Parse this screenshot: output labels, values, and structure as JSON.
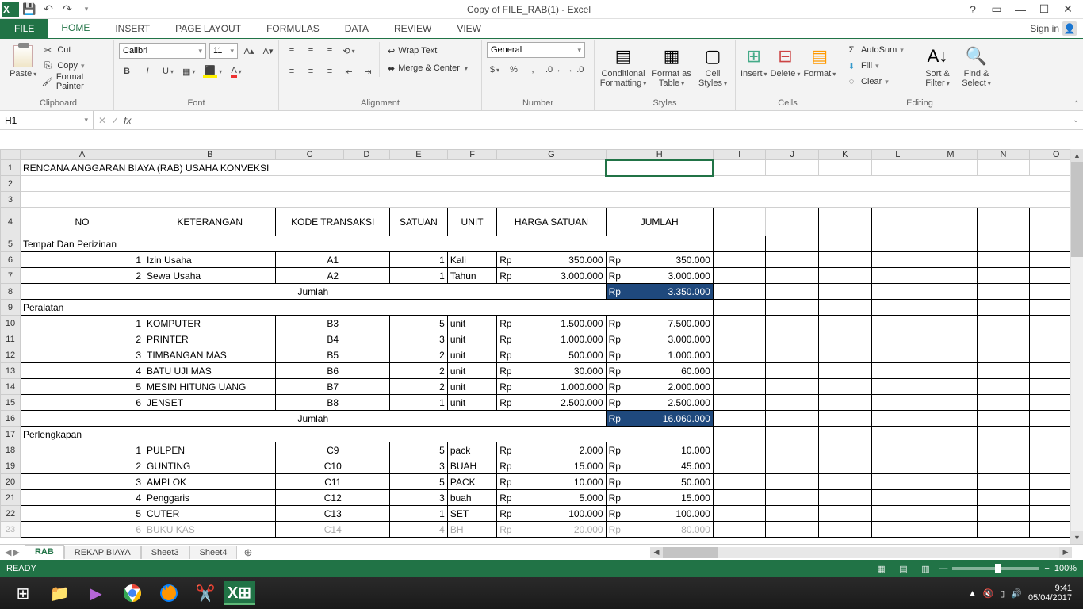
{
  "titleBar": {
    "title": "Copy of FILE_RAB(1) - Excel",
    "help": "?",
    "signIn": "Sign in"
  },
  "tabs": {
    "file": "FILE",
    "home": "HOME",
    "insert": "INSERT",
    "pageLayout": "PAGE LAYOUT",
    "formulas": "FORMULAS",
    "data": "DATA",
    "review": "REVIEW",
    "view": "VIEW"
  },
  "ribbon": {
    "clipboard": {
      "label": "Clipboard",
      "paste": "Paste",
      "cut": "Cut",
      "copy": "Copy",
      "painter": "Format Painter"
    },
    "font": {
      "label": "Font",
      "name": "Calibri",
      "size": "11"
    },
    "alignment": {
      "label": "Alignment",
      "wrap": "Wrap Text",
      "merge": "Merge & Center"
    },
    "number": {
      "label": "Number",
      "format": "General"
    },
    "styles": {
      "label": "Styles",
      "cond": "Conditional Formatting",
      "table": "Format as Table",
      "cell": "Cell Styles"
    },
    "cells": {
      "label": "Cells",
      "insert": "Insert",
      "delete": "Delete",
      "format": "Format"
    },
    "editing": {
      "label": "Editing",
      "autosum": "AutoSum",
      "fill": "Fill",
      "clear": "Clear",
      "sort": "Sort & Filter",
      "find": "Find & Select"
    }
  },
  "formulaBar": {
    "nameBox": "H1",
    "fx": "fx"
  },
  "columns": [
    "A",
    "B",
    "C",
    "D",
    "E",
    "F",
    "G",
    "H",
    "I",
    "J",
    "K",
    "L",
    "M",
    "N",
    "O"
  ],
  "sheet": {
    "title": "RENCANA ANGGARAN BIAYA (RAB) USAHA KONVEKSI",
    "headers": {
      "no": "NO",
      "ket": "KETERANGAN",
      "kode": "KODE TRANSAKSI",
      "satuan": "SATUAN",
      "unit": "UNIT",
      "harga": "HARGA SATUAN",
      "jumlah": "JUMLAH"
    },
    "sections": [
      {
        "label": "Tempat Dan Perizinan",
        "rows": [
          {
            "no": "1",
            "ket": "Izin Usaha",
            "kode": "A1",
            "satuan": "1",
            "unit": "Kali",
            "hargaRp": "Rp",
            "harga": "350.000",
            "jumRp": "Rp",
            "jum": "350.000"
          },
          {
            "no": "2",
            "ket": "Sewa Usaha",
            "kode": "A2",
            "satuan": "1",
            "unit": "Tahun",
            "hargaRp": "Rp",
            "harga": "3.000.000",
            "jumRp": "Rp",
            "jum": "3.000.000"
          }
        ],
        "jumlahLabel": "Jumlah",
        "jumlahRp": "Rp",
        "jumlahVal": "3.350.000"
      },
      {
        "label": "Peralatan",
        "rows": [
          {
            "no": "1",
            "ket": "KOMPUTER",
            "kode": "B3",
            "satuan": "5",
            "unit": "unit",
            "hargaRp": "Rp",
            "harga": "1.500.000",
            "jumRp": "Rp",
            "jum": "7.500.000"
          },
          {
            "no": "2",
            "ket": "PRINTER",
            "kode": "B4",
            "satuan": "3",
            "unit": "unit",
            "hargaRp": "Rp",
            "harga": "1.000.000",
            "jumRp": "Rp",
            "jum": "3.000.000"
          },
          {
            "no": "3",
            "ket": "TIMBANGAN MAS",
            "kode": "B5",
            "satuan": "2",
            "unit": "unit",
            "hargaRp": "Rp",
            "harga": "500.000",
            "jumRp": "Rp",
            "jum": "1.000.000"
          },
          {
            "no": "4",
            "ket": "BATU UJI MAS",
            "kode": "B6",
            "satuan": "2",
            "unit": "unit",
            "hargaRp": "Rp",
            "harga": "30.000",
            "jumRp": "Rp",
            "jum": "60.000"
          },
          {
            "no": "5",
            "ket": "MESIN HITUNG UANG",
            "kode": "B7",
            "satuan": "2",
            "unit": "unit",
            "hargaRp": "Rp",
            "harga": "1.000.000",
            "jumRp": "Rp",
            "jum": "2.000.000"
          },
          {
            "no": "6",
            "ket": "JENSET",
            "kode": "B8",
            "satuan": "1",
            "unit": "unit",
            "hargaRp": "Rp",
            "harga": "2.500.000",
            "jumRp": "Rp",
            "jum": "2.500.000"
          }
        ],
        "jumlahLabel": "Jumlah",
        "jumlahRp": "Rp",
        "jumlahVal": "16.060.000"
      },
      {
        "label": "Perlengkapan",
        "rows": [
          {
            "no": "1",
            "ket": "PULPEN",
            "kode": "C9",
            "satuan": "5",
            "unit": "pack",
            "hargaRp": "Rp",
            "harga": "2.000",
            "jumRp": "Rp",
            "jum": "10.000"
          },
          {
            "no": "2",
            "ket": "GUNTING",
            "kode": "C10",
            "satuan": "3",
            "unit": "BUAH",
            "hargaRp": "Rp",
            "harga": "15.000",
            "jumRp": "Rp",
            "jum": "45.000"
          },
          {
            "no": "3",
            "ket": "AMPLOK",
            "kode": "C11",
            "satuan": "5",
            "unit": "PACK",
            "hargaRp": "Rp",
            "harga": "10.000",
            "jumRp": "Rp",
            "jum": "50.000"
          },
          {
            "no": "4",
            "ket": "Penggaris",
            "kode": "C12",
            "satuan": "3",
            "unit": "buah",
            "hargaRp": "Rp",
            "harga": "5.000",
            "jumRp": "Rp",
            "jum": "15.000"
          },
          {
            "no": "5",
            "ket": "CUTER",
            "kode": "C13",
            "satuan": "1",
            "unit": "SET",
            "hargaRp": "Rp",
            "harga": "100.000",
            "jumRp": "Rp",
            "jum": "100.000"
          },
          {
            "no": "6",
            "ket": "BUKU KAS",
            "kode": "C14",
            "satuan": "4",
            "unit": "BH",
            "hargaRp": "Rp",
            "harga": "20.000",
            "jumRp": "Rp",
            "jum": "80.000"
          }
        ]
      }
    ]
  },
  "sheetTabs": {
    "active": "RAB",
    "others": [
      "REKAP BIAYA",
      "Sheet3",
      "Sheet4"
    ]
  },
  "statusBar": {
    "ready": "READY",
    "zoom": "100%"
  },
  "taskbar": {
    "time": "9:41",
    "date": "05/04/2017"
  }
}
